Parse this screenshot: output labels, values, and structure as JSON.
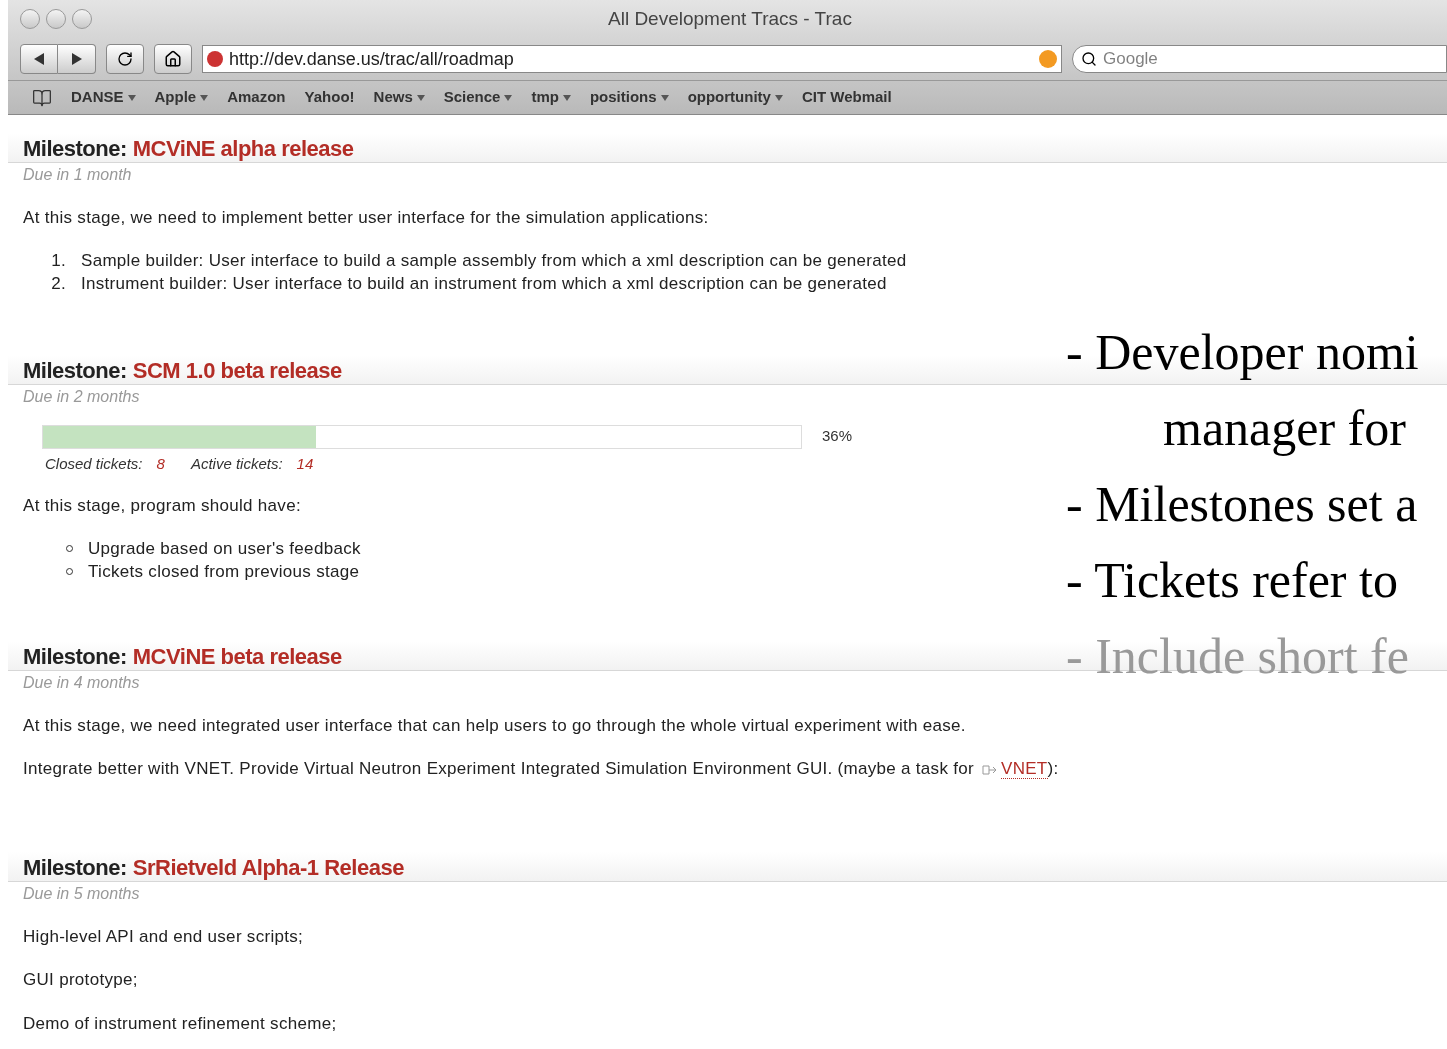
{
  "window": {
    "title": "All Development Tracs - Trac"
  },
  "toolbar": {
    "url": "http://dev.danse.us/trac/all/roadmap",
    "search_placeholder": "Google"
  },
  "bookmarks": [
    {
      "label": "DANSE",
      "menu": true
    },
    {
      "label": "Apple",
      "menu": true
    },
    {
      "label": "Amazon",
      "menu": false
    },
    {
      "label": "Yahoo!",
      "menu": false
    },
    {
      "label": "News",
      "menu": true
    },
    {
      "label": "Science",
      "menu": true
    },
    {
      "label": "tmp",
      "menu": true
    },
    {
      "label": "positions",
      "menu": true
    },
    {
      "label": "opportunity",
      "menu": true
    },
    {
      "label": "CIT Webmail",
      "menu": false
    }
  ],
  "milestones": [
    {
      "prefix": "Milestone:",
      "name": "MCViNE alpha release",
      "due": "Due in 1 month",
      "blocks": [
        {
          "kind": "paragraph",
          "text": "At this stage, we need to implement better user interface for the simulation applications:"
        },
        {
          "kind": "ordered_list",
          "items": [
            {
              "number": "1.",
              "text": "Sample builder: User interface to build a sample assembly from which a xml description can be generated"
            },
            {
              "number": "2.",
              "text": "Instrument builder: User interface to build an instrument from which a xml description can be generated"
            }
          ]
        }
      ]
    },
    {
      "prefix": "Milestone:",
      "name": "SCM 1.0 beta release",
      "due": "Due in 2 months",
      "progress": {
        "level": 0.36,
        "percent": "36%",
        "closed_label": "Closed tickets:",
        "closed": "8",
        "active_label": "Active tickets:",
        "active": "14"
      },
      "blocks": [
        {
          "kind": "paragraph",
          "text": "At this stage, program should have:"
        },
        {
          "kind": "bullet_list",
          "items": [
            "Upgrade based on user's feedback",
            "Tickets closed from previous stage"
          ]
        }
      ]
    },
    {
      "prefix": "Milestone:",
      "name": "MCViNE beta release",
      "due": "Due in 4 months",
      "blocks": [
        {
          "kind": "paragraph",
          "text": "At this stage, we need integrated user interface that can help users to go through the whole virtual experiment with ease."
        },
        {
          "kind": "link_paragraph",
          "before": "Integrate better with VNET. Provide Virtual Neutron Experiment Integrated Simulation Environment GUI. (maybe a task for ",
          "link": "VNET",
          "after": "):"
        }
      ]
    },
    {
      "prefix": "Milestone:",
      "name": "SrRietveld Alpha-1 Release",
      "due": "Due in 5 months",
      "blocks": [
        {
          "kind": "paragraph",
          "text": "High-level API and end user scripts;"
        },
        {
          "kind": "paragraph",
          "text": "GUI prototype;"
        },
        {
          "kind": "paragraph",
          "text": "Demo of instrument refinement scheme;"
        }
      ]
    }
  ],
  "slide_bullets": [
    {
      "text": "- Developer nomi",
      "indent": false,
      "dimmed": false
    },
    {
      "text": "manager for",
      "indent": true,
      "dimmed": false
    },
    {
      "text": "- Milestones set a",
      "indent": false,
      "dimmed": false
    },
    {
      "text": "- Tickets refer to",
      "indent": false,
      "dimmed": false
    },
    {
      "text": "- Include short fe",
      "indent": false,
      "dimmed": true
    }
  ]
}
